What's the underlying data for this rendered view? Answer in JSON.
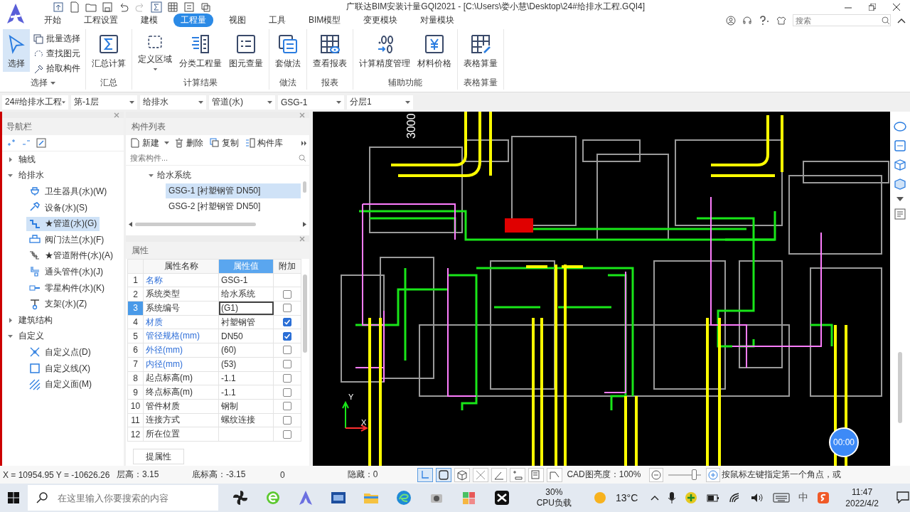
{
  "window": {
    "title": "广联达BIM安装计量GQI2021 - [C:\\Users\\娄小慧\\Desktop\\24#给排水工程.GQI4]"
  },
  "menu_tabs": [
    {
      "label": "开始",
      "selected": false
    },
    {
      "label": "工程设置",
      "selected": false
    },
    {
      "label": "建模",
      "selected": false
    },
    {
      "label": "工程量",
      "selected": true
    },
    {
      "label": "视图",
      "selected": false
    },
    {
      "label": "工具",
      "selected": false
    },
    {
      "label": "BIM模型",
      "selected": false
    },
    {
      "label": "变更模块",
      "selected": false
    },
    {
      "label": "对量模块",
      "selected": false
    }
  ],
  "search": {
    "placeholder": "搜索"
  },
  "ribbon_groups": [
    {
      "label": "选择",
      "buttons": [
        {
          "label": "选择",
          "kind": "large",
          "selected": true
        },
        {
          "label": "批量选择",
          "kind": "small",
          "selected": false
        },
        {
          "label": "查找图元",
          "kind": "small",
          "selected": false
        },
        {
          "label": "拾取构件",
          "kind": "small",
          "selected": false
        }
      ]
    },
    {
      "label": "汇总",
      "buttons": [
        {
          "label": "汇总计算",
          "kind": "large",
          "selected": false
        }
      ]
    },
    {
      "label": "计算结果",
      "buttons": [
        {
          "label": "定义区域",
          "kind": "large",
          "selected": false
        },
        {
          "label": "分类工程量",
          "kind": "large",
          "selected": false
        },
        {
          "label": "图元查量",
          "kind": "large",
          "selected": false
        }
      ]
    },
    {
      "label": "做法",
      "buttons": [
        {
          "label": "套做法",
          "kind": "large",
          "selected": false
        }
      ]
    },
    {
      "label": "报表",
      "buttons": [
        {
          "label": "查看报表",
          "kind": "large",
          "selected": false
        }
      ]
    },
    {
      "label": "辅助功能",
      "buttons": [
        {
          "label": "计算精度管理",
          "kind": "large",
          "selected": false
        },
        {
          "label": "材料价格",
          "kind": "large",
          "selected": false
        }
      ]
    },
    {
      "label": "表格算量",
      "buttons": [
        {
          "label": "表格算量",
          "kind": "large",
          "selected": false
        }
      ]
    }
  ],
  "selectors": [
    "24#给排水工程",
    "第-1层",
    "给排水",
    "管道(水)",
    "GSG-1",
    "分层1"
  ],
  "navigation": {
    "title": "导航栏",
    "tree": [
      {
        "label": "轴线",
        "expanded": false
      },
      {
        "label": "给排水",
        "expanded": true,
        "children": [
          {
            "label": "卫生器具(水)(W)",
            "selected": false
          },
          {
            "label": "设备(水)(S)",
            "selected": false
          },
          {
            "label": "★管道(水)(G)",
            "selected": true
          },
          {
            "label": "阀门法兰(水)(F)",
            "selected": false
          },
          {
            "label": "★管道附件(水)(A)",
            "selected": false
          },
          {
            "label": "通头管件(水)(J)",
            "selected": false
          },
          {
            "label": "零星构件(水)(K)",
            "selected": false
          },
          {
            "label": "支架(水)(Z)",
            "selected": false
          }
        ]
      },
      {
        "label": "建筑结构",
        "expanded": false
      },
      {
        "label": "自定义",
        "expanded": true,
        "children": [
          {
            "label": "自定义点(D)",
            "selected": false
          },
          {
            "label": "自定义线(X)",
            "selected": false
          },
          {
            "label": "自定义面(M)",
            "selected": false
          }
        ]
      }
    ]
  },
  "component_list": {
    "title": "构件列表",
    "toolbar": [
      "新建",
      "删除",
      "复制",
      "构件库"
    ],
    "search": {
      "placeholder": "搜索构件..."
    },
    "tree": [
      {
        "label": "给水系统",
        "expanded": true,
        "children": [
          {
            "label": "GSG-1 [衬塑钢管 DN50]",
            "selected": true
          },
          {
            "label": "GSG-2 [衬塑钢管 DN50]",
            "selected": false
          }
        ]
      }
    ]
  },
  "properties": {
    "title": "属性",
    "columns": [
      "属性名称",
      "属性值",
      "附加"
    ],
    "rows": [
      {
        "index": "1",
        "name": "名称",
        "value": "GSG-1",
        "public": true,
        "selected": false
      },
      {
        "index": "2",
        "name": "系统类型",
        "value": "给水系统",
        "public": false,
        "selected": false,
        "checked": false
      },
      {
        "index": "3",
        "name": "系统编号",
        "value": "(G1)",
        "public": false,
        "selected": true,
        "checked": false
      },
      {
        "index": "4",
        "name": "材质",
        "value": "衬塑钢管",
        "public": true,
        "selected": false,
        "checked": true
      },
      {
        "index": "5",
        "name": "管径规格(mm)",
        "value": "DN50",
        "public": true,
        "selected": false,
        "checked": true
      },
      {
        "index": "6",
        "name": "外径(mm)",
        "value": "(60)",
        "public": true,
        "selected": false,
        "checked": false
      },
      {
        "index": "7",
        "name": "内径(mm)",
        "value": "(53)",
        "public": true,
        "selected": false,
        "checked": false
      },
      {
        "index": "8",
        "name": "起点标高(m)",
        "value": "-1.1",
        "public": false,
        "selected": false,
        "checked": false
      },
      {
        "index": "9",
        "name": "终点标高(m)",
        "value": "-1.1",
        "public": false,
        "selected": false,
        "checked": false
      },
      {
        "index": "10",
        "name": "管件材质",
        "value": "钢制",
        "public": false,
        "selected": false,
        "checked": false
      },
      {
        "index": "11",
        "name": "连接方式",
        "value": "螺纹连接",
        "public": false,
        "selected": false,
        "checked": false
      },
      {
        "index": "12",
        "name": "所在位置",
        "value": "",
        "public": false,
        "selected": false,
        "checked": false
      }
    ],
    "button": "提属性"
  },
  "canvas": {
    "dimension": "3000",
    "axis_x": "X",
    "axis_y": "Y",
    "timer": "00:00"
  },
  "status_bar": {
    "coordinates": "X = 10954.95 Y = -10626.26",
    "floor_height": "层高：3.15",
    "base_elevation": "底标高：-3.15",
    "count": "0",
    "hidden": "隐藏：0",
    "tools": [
      {
        "on": true
      },
      {
        "on": true
      },
      {
        "on": false
      },
      {
        "on": false
      },
      {
        "on": false
      },
      {
        "on": false
      },
      {
        "on": false
      },
      {
        "on": false
      }
    ],
    "brightness_label": "CAD图亮度：100%",
    "brightness": {
      "level": 0.8
    },
    "hint": "按鼠标左键指定第一个角点，或"
  },
  "taskbar": {
    "search": {
      "placeholder": "在这里输入你要搜索的内容"
    },
    "cpu_value": "30%",
    "cpu_label": "CPU负载",
    "temperature": "13°C",
    "ime": "中",
    "time": "11:47",
    "date": "2022/4/2"
  }
}
